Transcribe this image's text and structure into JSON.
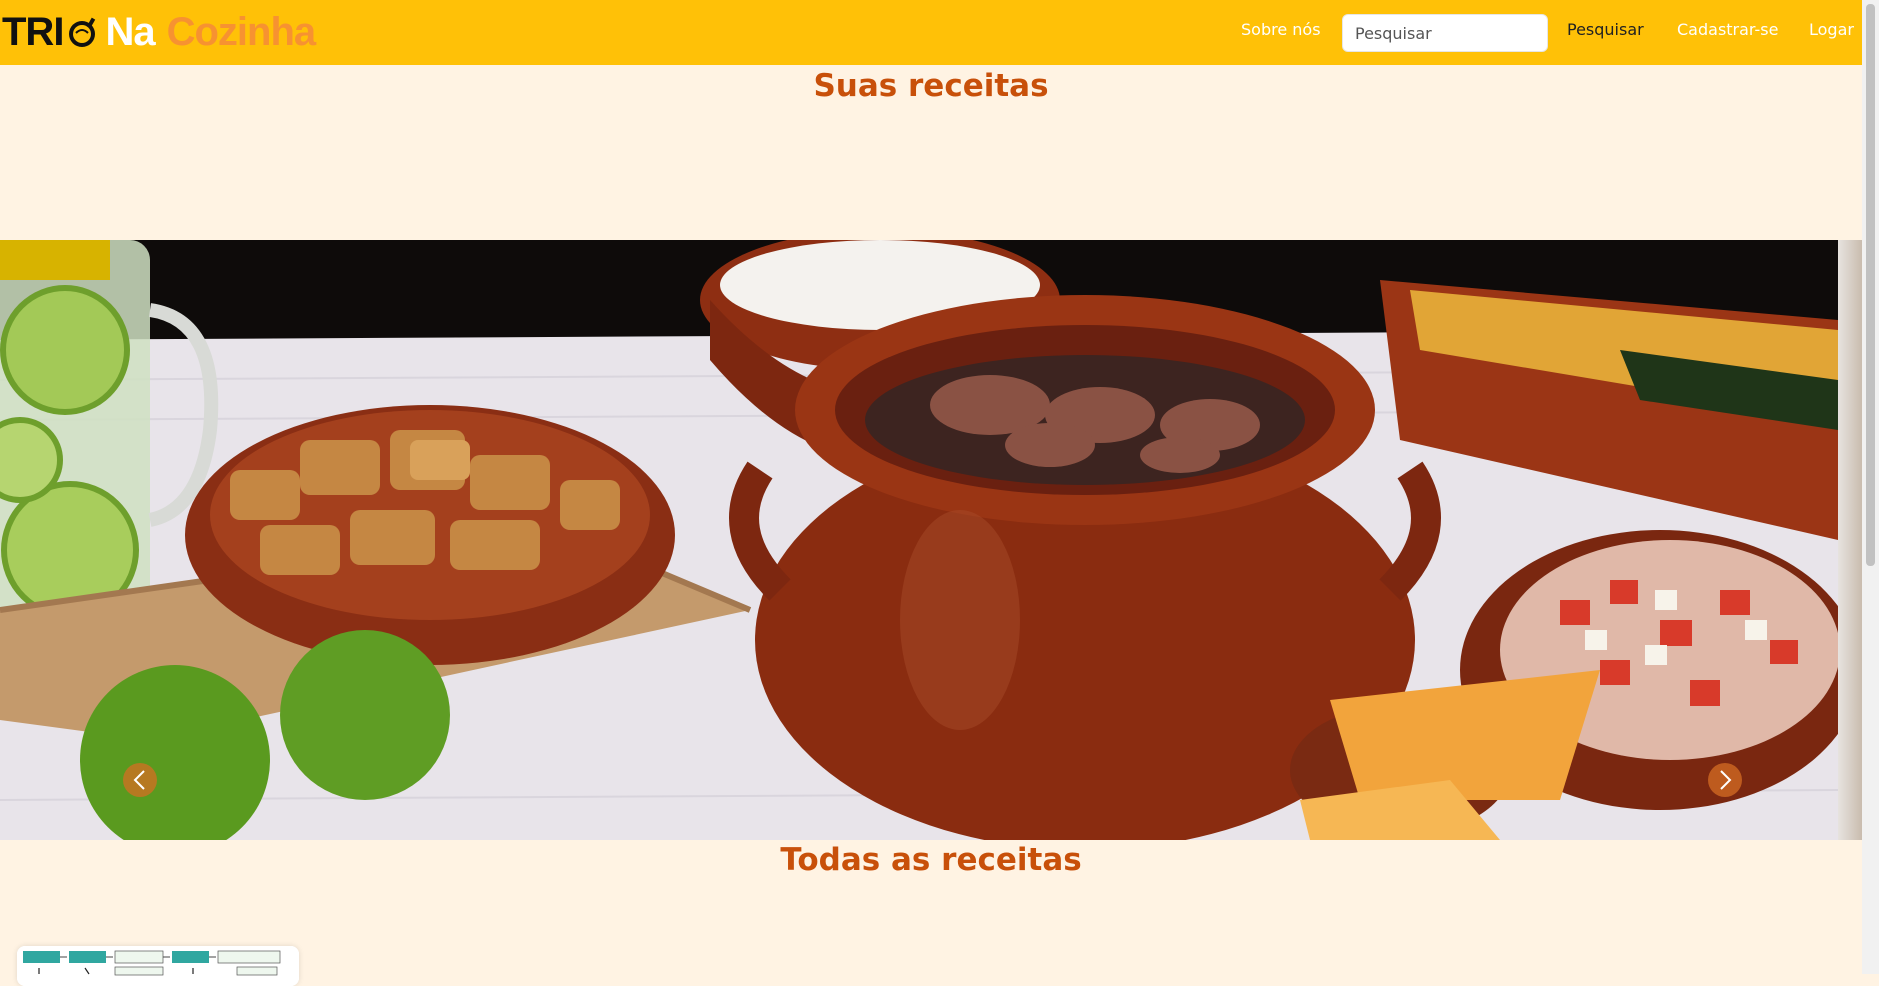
{
  "navbar": {
    "brand": {
      "word1": "TRI",
      "word2": "Na",
      "word3": "Cozinha"
    },
    "links": {
      "about": "Sobre nós",
      "register": "Cadastrar-se",
      "login": "Logar"
    },
    "search": {
      "placeholder": "Pesquisar",
      "button_label": "Pesquisar"
    }
  },
  "sections": {
    "your_recipes": "Suas receitas",
    "all_recipes": "Todas as receitas"
  },
  "carousel": {
    "icons": {
      "prev": "chevron-left-icon",
      "next": "chevron-right-icon"
    }
  },
  "colors": {
    "navbar": "#ffc107",
    "background": "#fff3e3",
    "heading": "#c8500a",
    "brand_accent": "#f79231"
  }
}
